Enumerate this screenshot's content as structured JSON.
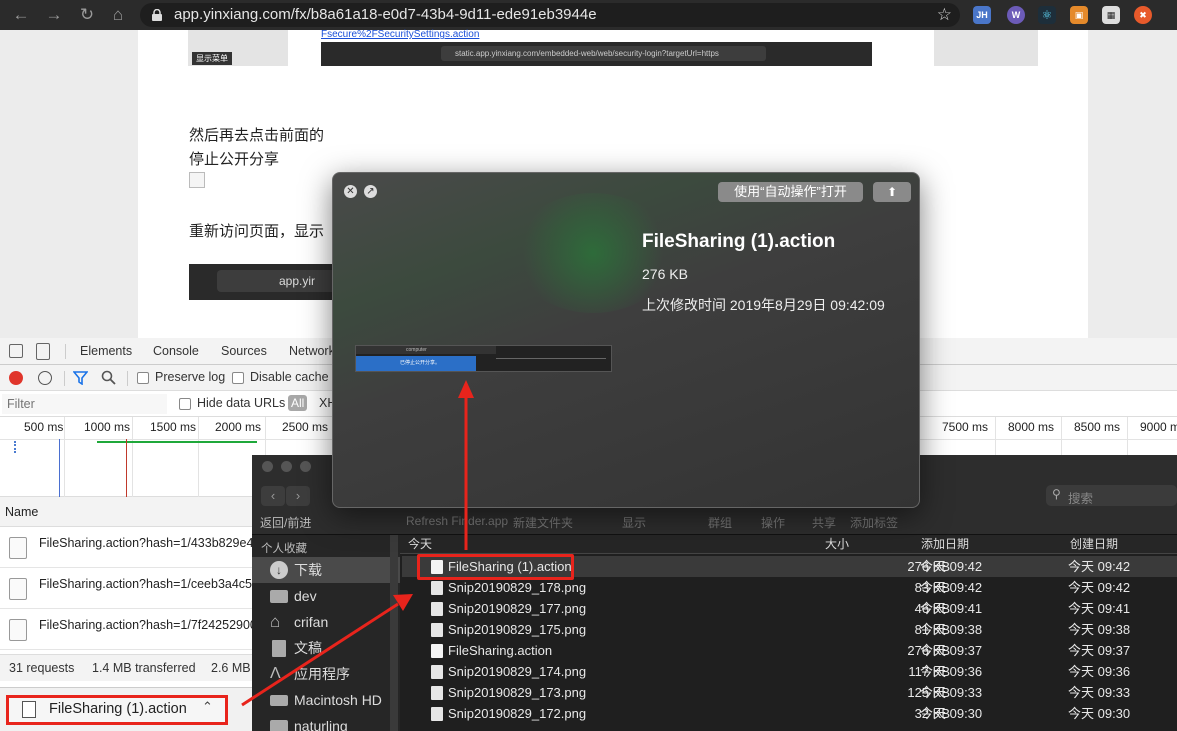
{
  "browser": {
    "url": "app.yinxiang.com/fx/b8a61a18-e0d7-43b4-9d11-ede91eb3944e",
    "extensions": [
      "JH",
      "W",
      "R",
      "O",
      "QR",
      "X"
    ]
  },
  "page": {
    "link_text": "Fsecure%2FSecuritySettings.action",
    "screenshot_label": "显示菜单",
    "inner_url": "static.app.yinxiang.com/embedded-web/web/security-login?targetUrl=https",
    "para1": "然后再去点击前面的",
    "para2": "停止公开分享",
    "para3": "重新访问页面，显示",
    "inner_url2": "app.yir"
  },
  "devtools": {
    "tabs": [
      "Elements",
      "Console",
      "Sources",
      "Network"
    ],
    "preserve_log": "Preserve log",
    "disable_cache": "Disable cache",
    "filter_placeholder": "Filter",
    "hide_data_urls": "Hide data URLs",
    "all_label": "All",
    "xhr_label": "XH",
    "ticks_left": [
      "500 ms",
      "1000 ms",
      "1500 ms",
      "2000 ms",
      "2500 ms"
    ],
    "ticks_right": [
      "7500 ms",
      "8000 ms",
      "8500 ms",
      "9000 m"
    ],
    "name_header": "Name",
    "requests": [
      "FileSharing.action?hash=1/433b829e4b",
      "FileSharing.action?hash=1/ceeb3a4c51",
      "FileSharing.action?hash=1/7f24252900"
    ],
    "status": {
      "requests": "31 requests",
      "transferred": "1.4 MB transferred",
      "size": "2.6 MB"
    }
  },
  "download_bar": {
    "file": "FileSharing (1).action"
  },
  "quicklook": {
    "open_with": "使用“自动操作”打开",
    "title": "FileSharing (1).action",
    "size": "276 KB",
    "modified": "上次修改时间 2019年8月29日 09:42:09",
    "thumb_text1": "computer",
    "thumb_text2": "已停止公开分享。"
  },
  "finder": {
    "back_forward": "返回/前进",
    "toolbar": [
      "Refresh Finder.app",
      "新建文件夹",
      "显示",
      "群组",
      "操作",
      "共享",
      "添加标签"
    ],
    "search_placeholder": "搜索",
    "sidebar_title": "个人收藏",
    "sidebar": [
      "下载",
      "dev",
      "crifan",
      "文稿",
      "应用程序",
      "Macintosh HD",
      "naturling"
    ],
    "columns": [
      "今天",
      "大小",
      "添加日期",
      "创建日期"
    ],
    "files": [
      {
        "name": "FileSharing (1).action",
        "size": "276 KB",
        "added": "今天 09:42",
        "created": "今天 09:42"
      },
      {
        "name": "Snip20190829_178.png",
        "size": "83 KB",
        "added": "今天 09:42",
        "created": "今天 09:42"
      },
      {
        "name": "Snip20190829_177.png",
        "size": "46 KB",
        "added": "今天 09:41",
        "created": "今天 09:41"
      },
      {
        "name": "Snip20190829_175.png",
        "size": "81 KB",
        "added": "今天 09:38",
        "created": "今天 09:38"
      },
      {
        "name": "FileSharing.action",
        "size": "276 KB",
        "added": "今天 09:37",
        "created": "今天 09:37"
      },
      {
        "name": "Snip20190829_174.png",
        "size": "117 KB",
        "added": "今天 09:36",
        "created": "今天 09:36"
      },
      {
        "name": "Snip20190829_173.png",
        "size": "125 KB",
        "added": "今天 09:33",
        "created": "今天 09:33"
      },
      {
        "name": "Snip20190829_172.png",
        "size": "32 KB",
        "added": "今天 09:30",
        "created": "今天 09:30"
      }
    ]
  },
  "colors": {
    "annotation": "#e8241c",
    "record": "#e0352b",
    "filter_icon": "#1a73e8"
  }
}
